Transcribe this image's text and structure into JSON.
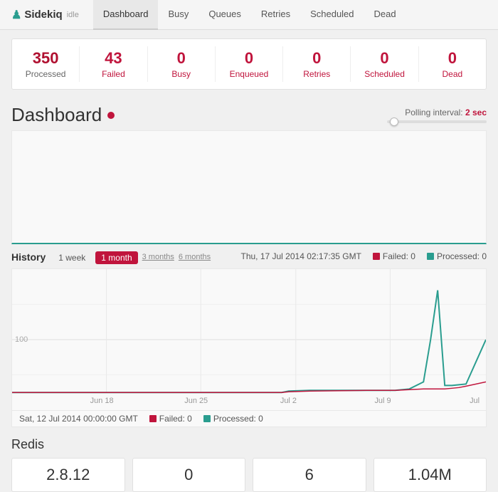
{
  "app": {
    "name": "Sidekiq",
    "icon": "♟",
    "status": "idle"
  },
  "nav": {
    "items": [
      {
        "label": "Dashboard",
        "active": true
      },
      {
        "label": "Busy",
        "active": false
      },
      {
        "label": "Queues",
        "active": false
      },
      {
        "label": "Retries",
        "active": false
      },
      {
        "label": "Scheduled",
        "active": false
      },
      {
        "label": "Dead",
        "active": false
      }
    ]
  },
  "stats": [
    {
      "value": "350",
      "label": "Processed",
      "color": "dark-red"
    },
    {
      "value": "43",
      "label": "Failed",
      "color": "red"
    },
    {
      "value": "0",
      "label": "Busy",
      "color": "red"
    },
    {
      "value": "0",
      "label": "Enqueued",
      "color": "red"
    },
    {
      "value": "0",
      "label": "Retries",
      "color": "red"
    },
    {
      "value": "0",
      "label": "Scheduled",
      "color": "red"
    },
    {
      "value": "0",
      "label": "Dead",
      "color": "red"
    }
  ],
  "dashboard": {
    "title": "Dashboard",
    "polling_label": "Polling interval:",
    "polling_value": "2 sec"
  },
  "history": {
    "label": "History",
    "buttons": [
      "1 week",
      "1 month",
      "3 months",
      "6 months"
    ],
    "active_button": "1 month",
    "date_hover": "Thu, 17 Jul 2014 02:17:35 GMT",
    "bottom_date": "Sat, 12 Jul 2014 00:00:00 GMT",
    "legend": [
      {
        "label": "Failed: 0",
        "color": "red"
      },
      {
        "label": "Processed: 0",
        "color": "teal"
      }
    ],
    "x_labels": [
      "Jun 18",
      "Jun 25",
      "Jul 2",
      "Jul 9",
      "Jul"
    ],
    "y_label": "100"
  },
  "redis": {
    "title": "Redis",
    "cards": [
      {
        "value": "2.8.12"
      },
      {
        "value": "0"
      },
      {
        "value": "6"
      },
      {
        "value": "1.04M"
      }
    ]
  }
}
